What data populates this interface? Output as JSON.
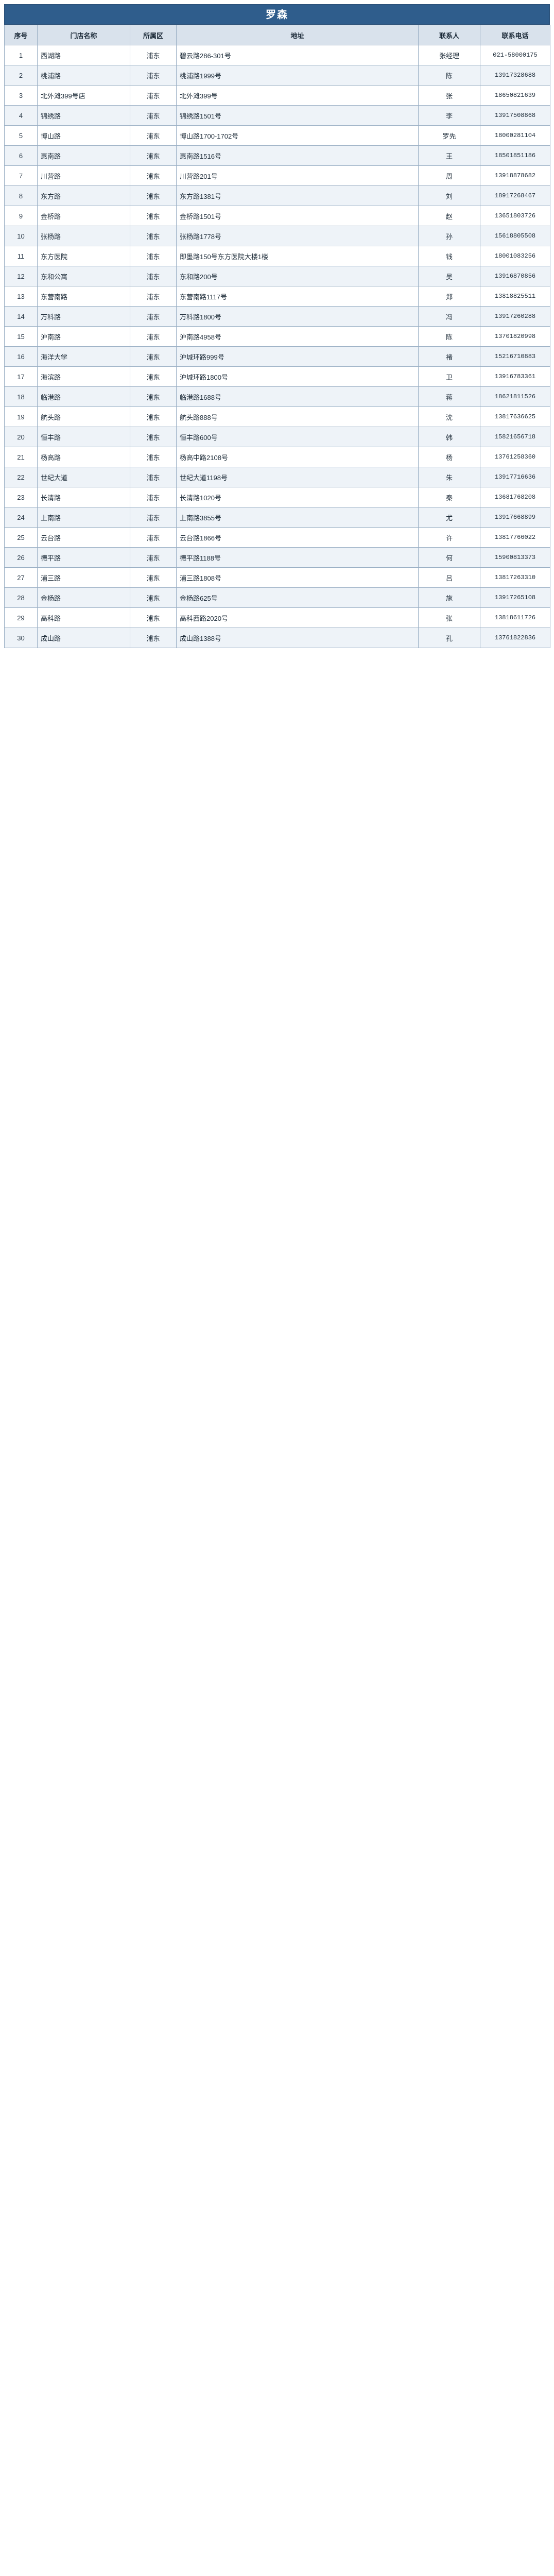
{
  "sheet": {
    "title": "罗森"
  },
  "table": {
    "headers": {
      "idx": "序号",
      "name": "门店名称",
      "district": "所属区",
      "address": "地址",
      "person": "联系人",
      "phone": "联系电话"
    },
    "rows": [
      {
        "idx": "1",
        "name": "西湖路",
        "district": "浦东",
        "address": "碧云路286-301号",
        "person": "张经理",
        "phone": "021-58000175"
      },
      {
        "idx": "2",
        "name": "桃浦路",
        "district": "浦东",
        "address": "桃浦路1999号",
        "person": "陈",
        "phone": "13917328688"
      },
      {
        "idx": "3",
        "name": "北外滩399号店",
        "district": "浦东",
        "address": "北外滩399号",
        "person": "张",
        "phone": "18650821639"
      },
      {
        "idx": "4",
        "name": "锦绣路",
        "district": "浦东",
        "address": "锦绣路1501号",
        "person": "李",
        "phone": "13917508868"
      },
      {
        "idx": "5",
        "name": "博山路",
        "district": "浦东",
        "address": "博山路1700-1702号",
        "person": "罗先",
        "phone": "18000281104"
      },
      {
        "idx": "6",
        "name": "惠南路",
        "district": "浦东",
        "address": "惠南路1516号",
        "person": "王",
        "phone": "18501851186"
      },
      {
        "idx": "7",
        "name": "川营路",
        "district": "浦东",
        "address": "川营路201号",
        "person": "周",
        "phone": "13918878682"
      },
      {
        "idx": "8",
        "name": "东方路",
        "district": "浦东",
        "address": "东方路1381号",
        "person": "刘",
        "phone": "18917268467"
      },
      {
        "idx": "9",
        "name": "金桥路",
        "district": "浦东",
        "address": "金桥路1501号",
        "person": "赵",
        "phone": "13651803726"
      },
      {
        "idx": "10",
        "name": "张杨路",
        "district": "浦东",
        "address": "张杨路1778号",
        "person": "孙",
        "phone": "15618805508"
      },
      {
        "idx": "11",
        "name": "东方医院",
        "district": "浦东",
        "address": "即墨路150号东方医院大楼1楼",
        "person": "钱",
        "phone": "18001083256"
      },
      {
        "idx": "12",
        "name": "东和公寓",
        "district": "浦东",
        "address": "东和路200号",
        "person": "吴",
        "phone": "13916870856"
      },
      {
        "idx": "13",
        "name": "东营南路",
        "district": "浦东",
        "address": "东营南路1117号",
        "person": "郑",
        "phone": "13818825511"
      },
      {
        "idx": "14",
        "name": "万科路",
        "district": "浦东",
        "address": "万科路1800号",
        "person": "冯",
        "phone": "13917260288"
      },
      {
        "idx": "15",
        "name": "沪南路",
        "district": "浦东",
        "address": "沪南路4958号",
        "person": "陈",
        "phone": "13701820998"
      },
      {
        "idx": "16",
        "name": "海洋大学",
        "district": "浦东",
        "address": "沪城环路999号",
        "person": "褚",
        "phone": "15216710883"
      },
      {
        "idx": "17",
        "name": "海滨路",
        "district": "浦东",
        "address": "沪城环路1800号",
        "person": "卫",
        "phone": "13916783361"
      },
      {
        "idx": "18",
        "name": "临港路",
        "district": "浦东",
        "address": "临港路1688号",
        "person": "蒋",
        "phone": "18621811526"
      },
      {
        "idx": "19",
        "name": "航头路",
        "district": "浦东",
        "address": "航头路888号",
        "person": "沈",
        "phone": "13817636625"
      },
      {
        "idx": "20",
        "name": "恒丰路",
        "district": "浦东",
        "address": "恒丰路600号",
        "person": "韩",
        "phone": "15821656718"
      },
      {
        "idx": "21",
        "name": "杨高路",
        "district": "浦东",
        "address": "杨高中路2108号",
        "person": "杨",
        "phone": "13761258360"
      },
      {
        "idx": "22",
        "name": "世纪大道",
        "district": "浦东",
        "address": "世纪大道1198号",
        "person": "朱",
        "phone": "13917716636"
      },
      {
        "idx": "23",
        "name": "长清路",
        "district": "浦东",
        "address": "长清路1020号",
        "person": "秦",
        "phone": "13681768208"
      },
      {
        "idx": "24",
        "name": "上南路",
        "district": "浦东",
        "address": "上南路3855号",
        "person": "尤",
        "phone": "13917668899"
      },
      {
        "idx": "25",
        "name": "云台路",
        "district": "浦东",
        "address": "云台路1866号",
        "person": "许",
        "phone": "13817766022"
      },
      {
        "idx": "26",
        "name": "德平路",
        "district": "浦东",
        "address": "德平路1188号",
        "person": "何",
        "phone": "15900813373"
      },
      {
        "idx": "27",
        "name": "浦三路",
        "district": "浦东",
        "address": "浦三路1808号",
        "person": "吕",
        "phone": "13817263310"
      },
      {
        "idx": "28",
        "name": "金杨路",
        "district": "浦东",
        "address": "金杨路625号",
        "person": "施",
        "phone": "13917265108"
      },
      {
        "idx": "29",
        "name": "高科路",
        "district": "浦东",
        "address": "高科西路2020号",
        "person": "张",
        "phone": "13818611726"
      },
      {
        "idx": "30",
        "name": "成山路",
        "district": "浦东",
        "address": "成山路1388号",
        "person": "孔",
        "phone": "13761822836"
      }
    ]
  }
}
